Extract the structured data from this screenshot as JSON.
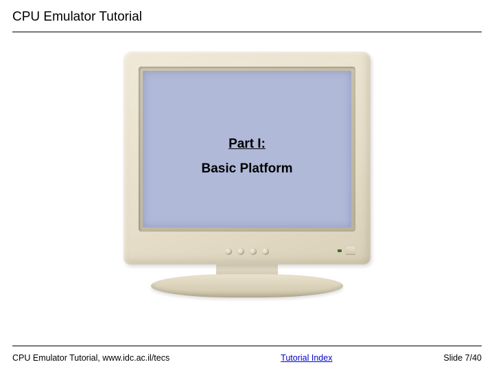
{
  "header": {
    "title": "CPU Emulator Tutorial"
  },
  "screen": {
    "part_label": "Part I:",
    "subtitle": "Basic Platform"
  },
  "footer": {
    "credit": "CPU Emulator Tutorial, www.idc.ac.il/tecs",
    "link_text": "Tutorial Index",
    "slide": "Slide 7/40"
  }
}
